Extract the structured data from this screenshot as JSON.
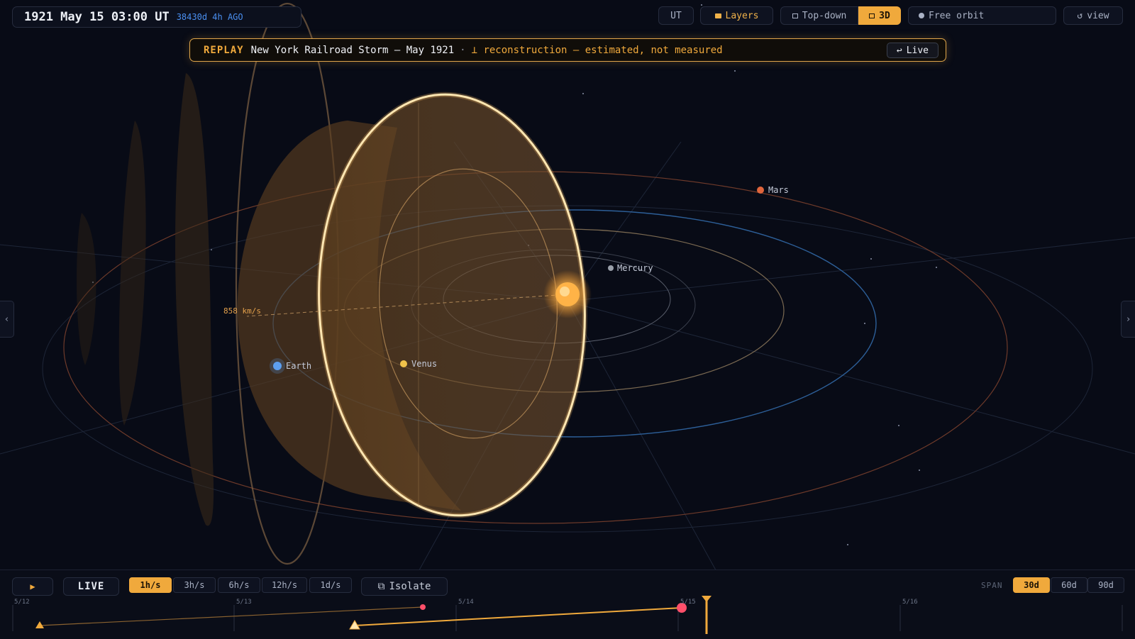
{
  "header": {
    "time": "1921 May 15 03:00 UT",
    "ago": "38430d 4h AGO"
  },
  "toolbar": {
    "ut_label": "UT",
    "layers_label": "Layers",
    "topdown_label": "Top-down",
    "view3d_label": "3D",
    "orbit_label": "Free orbit",
    "view_label": "view"
  },
  "banner": {
    "tag": "REPLAY",
    "title": "New York Railroad Storm — May 1921",
    "separator": "·",
    "note": "⊥ reconstruction — estimated, not measured",
    "live_label": "Live"
  },
  "scene": {
    "speed": "858 km/s",
    "planets": [
      {
        "name": "Mercury",
        "color": "#9aa0aa"
      },
      {
        "name": "Venus",
        "color": "#f0c24a"
      },
      {
        "name": "Earth",
        "color": "#5d9ff0"
      },
      {
        "name": "Mars",
        "color": "#e0653c"
      }
    ],
    "sun_color": "#ffb347",
    "cme_color": "#e8a550"
  },
  "controls": {
    "play_icon": "▶",
    "live_label": "LIVE",
    "rates": [
      "1h/s",
      "3h/s",
      "6h/s",
      "12h/s",
      "1d/s"
    ],
    "active_rate": "1h/s",
    "isolate_label": "Isolate",
    "span_label": "SPAN",
    "spans": [
      "30d",
      "60d",
      "90d"
    ],
    "active_span": "30d"
  },
  "timeline": {
    "ticks": [
      "5/12",
      "5/13",
      "5/14",
      "5/15",
      "5/16"
    ]
  },
  "colors": {
    "accent": "#f0a93c",
    "earth": "#5d9ff0",
    "event": "#ff4f6a"
  }
}
